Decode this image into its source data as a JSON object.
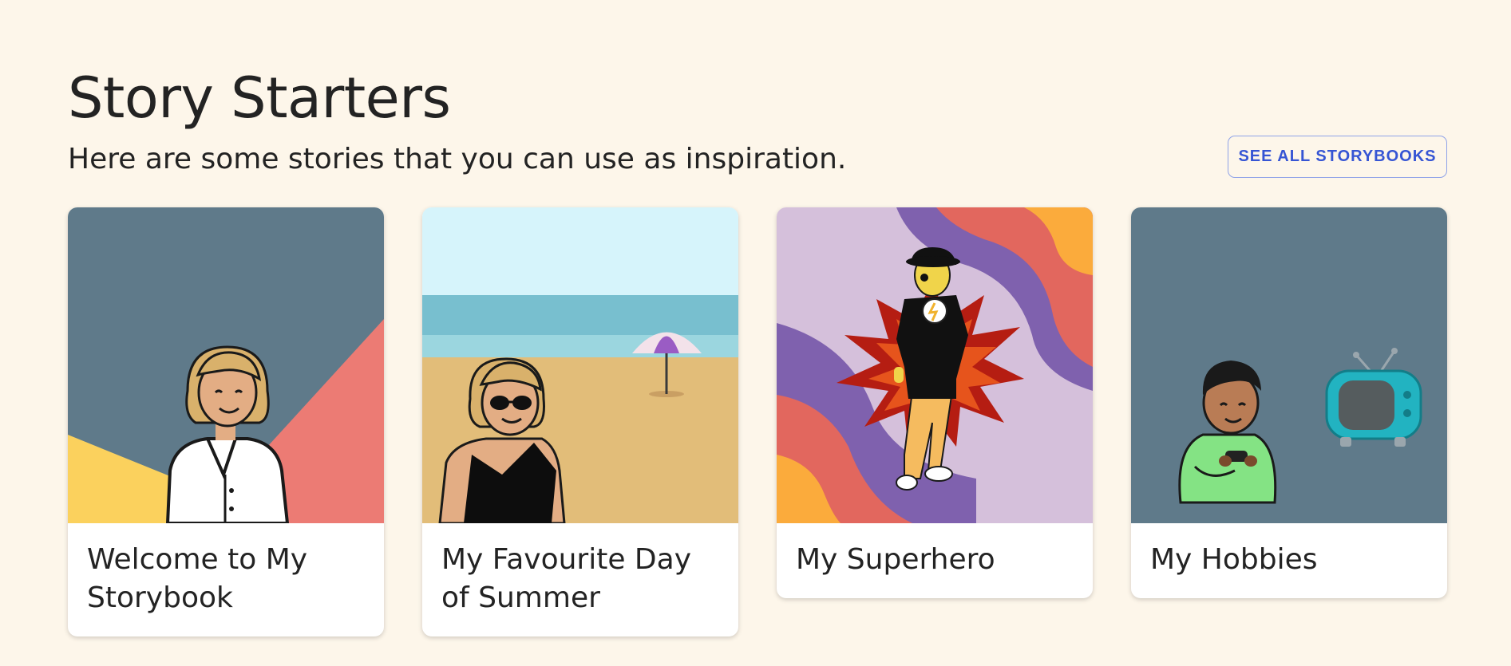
{
  "header": {
    "title": "Story Starters",
    "subtitle": "Here are some stories that you can use as inspiration.",
    "see_all_label": "SEE ALL STORYBOOKS"
  },
  "cards": [
    {
      "title": "Welcome to My Storybook",
      "illustration": "woman-white-shirt"
    },
    {
      "title": "My Favourite Day of Summer",
      "illustration": "woman-sunglasses-beach"
    },
    {
      "title": "My Superhero",
      "illustration": "superhero-burst"
    },
    {
      "title": "My Hobbies",
      "illustration": "boy-game-controller-tv"
    }
  ],
  "colors": {
    "background": "#fdf6ea",
    "accent": "#3655d4",
    "slate": "#5f7a8a"
  }
}
